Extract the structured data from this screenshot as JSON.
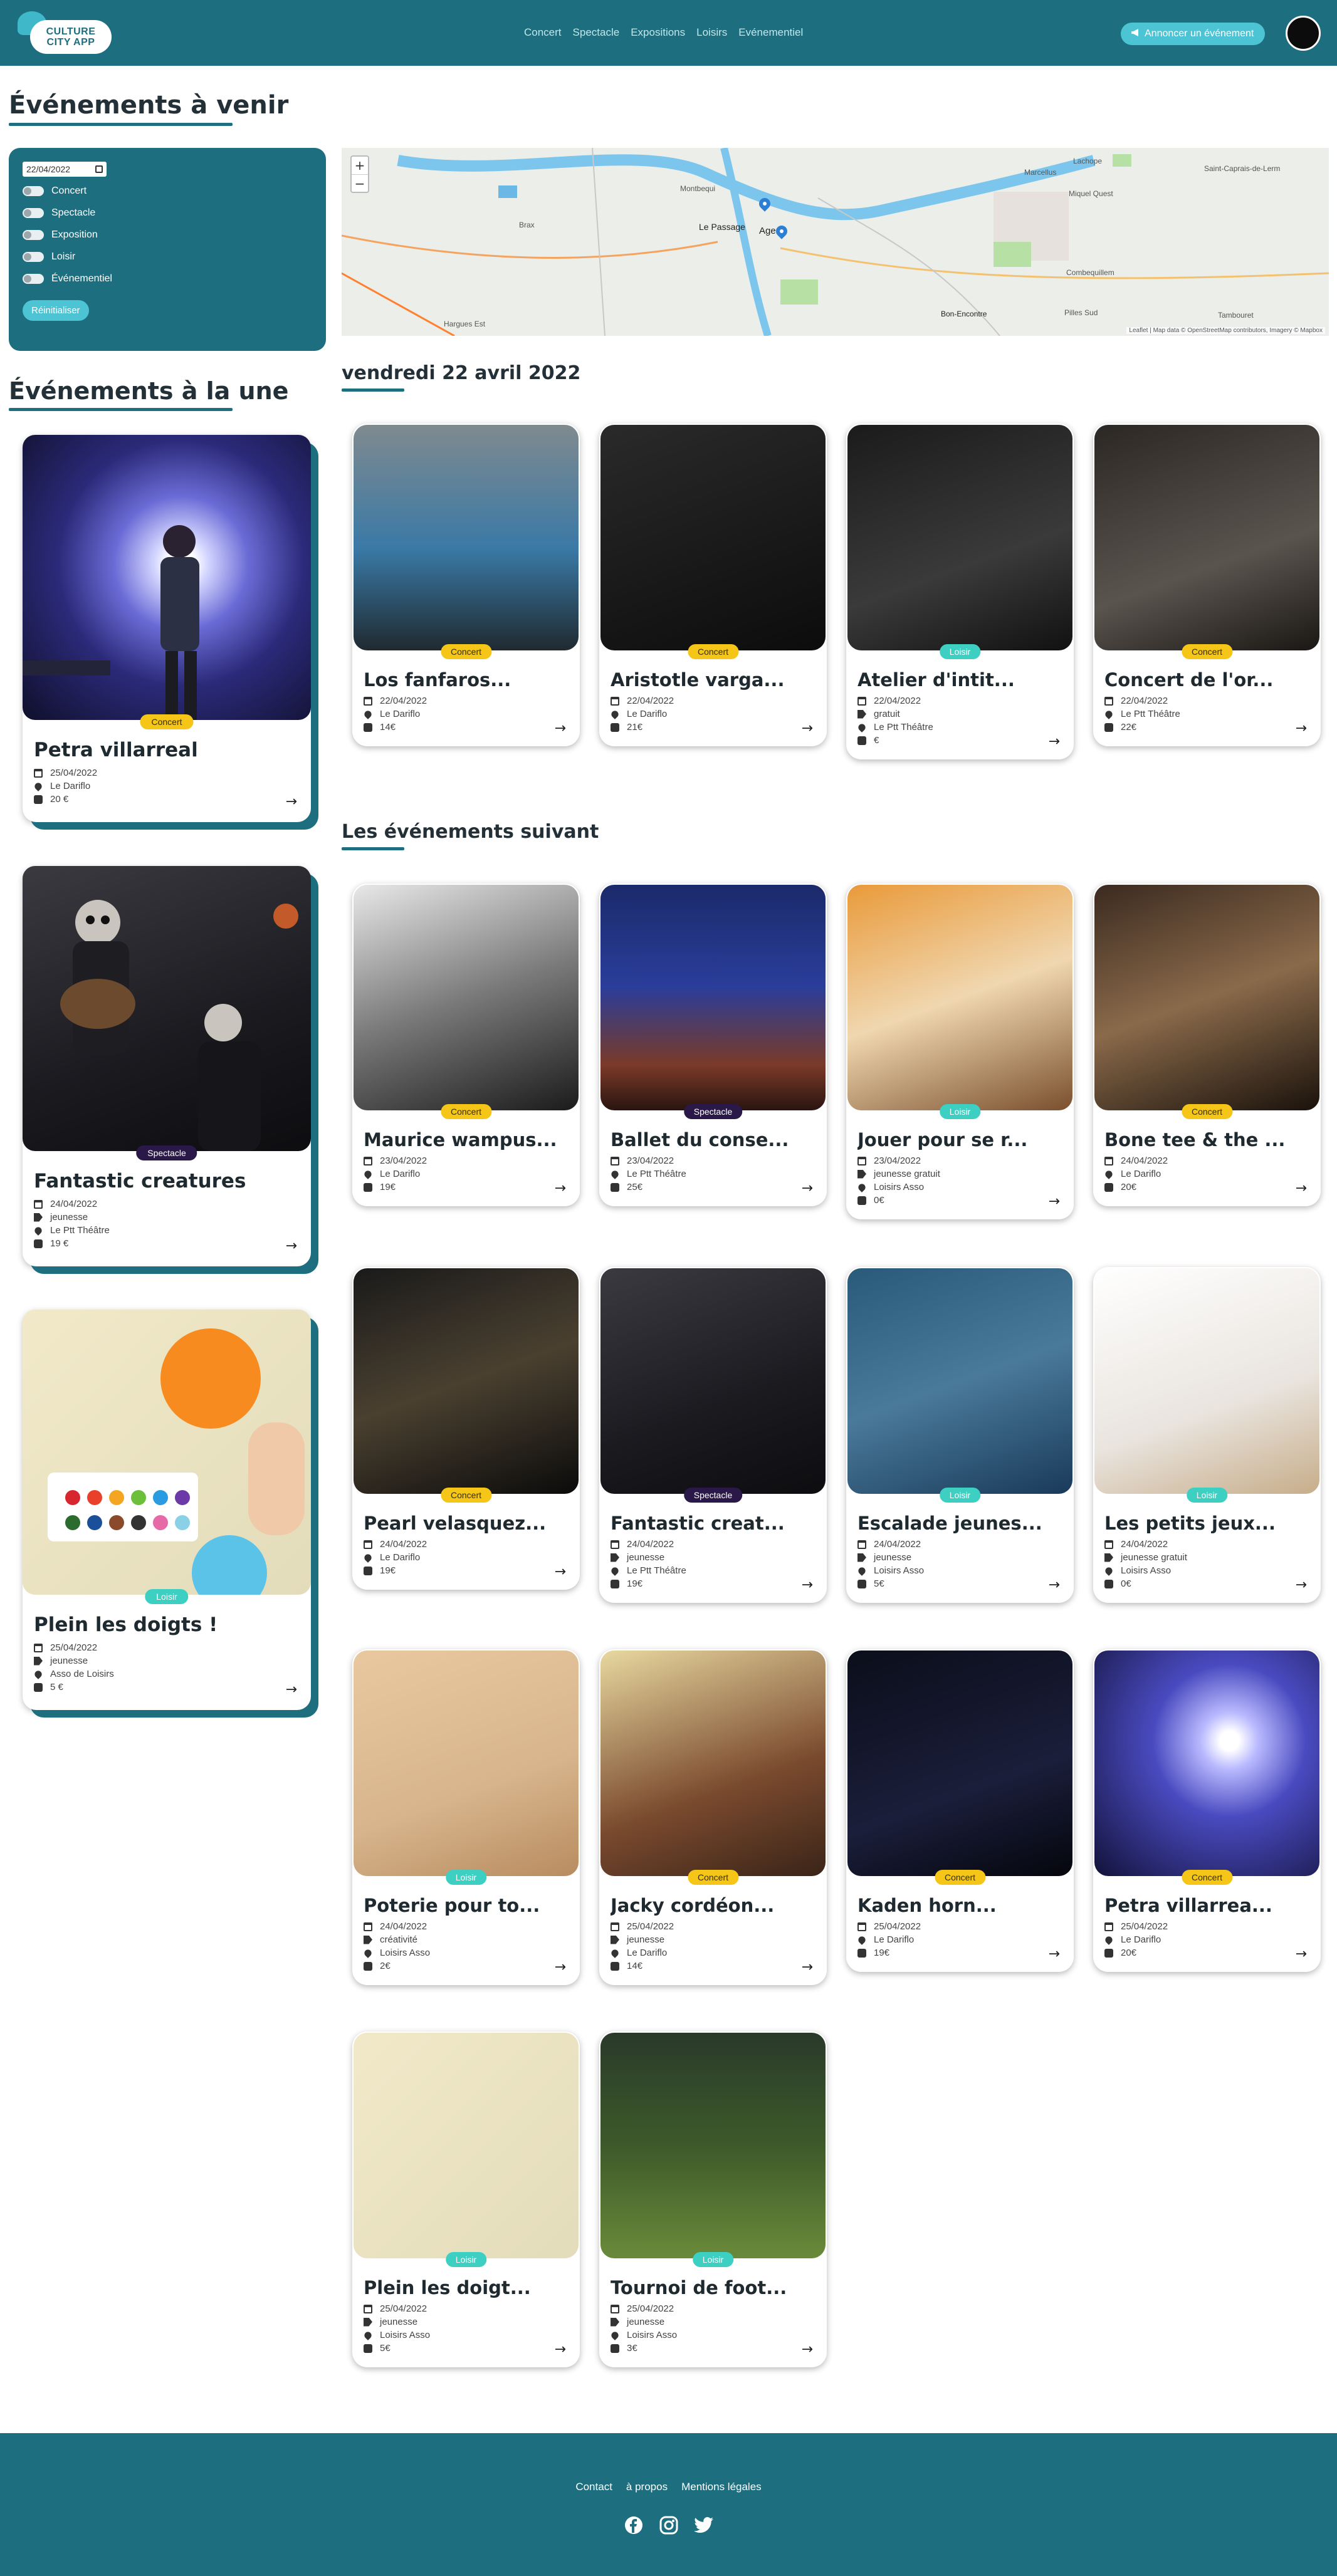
{
  "header": {
    "logo_line1": "CULTURE",
    "logo_line2": "CITY APP",
    "nav": [
      "Concert",
      "Spectacle",
      "Expositions",
      "Loisirs",
      "Evénementiel"
    ],
    "announce_label": "Annoncer un événement"
  },
  "upcoming_title": "Événements à venir",
  "featured_title": "Événements à la une",
  "filters": {
    "date_value": "22/04/2022",
    "options": [
      "Concert",
      "Spectacle",
      "Exposition",
      "Loisir",
      "Événementiel"
    ],
    "reset_label": "Réinitialiser"
  },
  "map": {
    "zoom_in": "+",
    "zoom_out": "−",
    "labels": [
      "Montbequi",
      "Le Passage",
      "Agen",
      "Brax",
      "Bon-Encontre",
      "Lachope",
      "Saint-Caprais-de-Lerm",
      "Marcellus",
      "Miquel Quest",
      "Combequillem",
      "Pilles Sud",
      "Tambouret",
      "Hargues Est"
    ],
    "attribution": "Leaflet | Map data © OpenStreetMap contributors, Imagery © Mapbox"
  },
  "day_title": "vendredi 22 avril 2022",
  "next_title": "Les événements suivant",
  "featured": [
    {
      "title": "Petra villarreal",
      "category": "Concert",
      "date": "25/04/2022",
      "place": "Le Dariflo",
      "price": "20 €"
    },
    {
      "title": "Fantastic creatures",
      "category": "Spectacle",
      "date": "24/04/2022",
      "tag": "jeunesse",
      "place": "Le Ptt Théâtre",
      "price": "19 €"
    },
    {
      "title": "Plein les doigts !",
      "category": "Loisir",
      "date": "25/04/2022",
      "tag": "jeunesse",
      "place": "Asso de Loisirs",
      "price": "5 €"
    }
  ],
  "today": [
    {
      "title": "Los fanfaros...",
      "category": "Concert",
      "date": "22/04/2022",
      "place": "Le Dariflo",
      "price": "14€"
    },
    {
      "title": "Aristotle varga...",
      "category": "Concert",
      "date": "22/04/2022",
      "place": "Le Dariflo",
      "price": "21€"
    },
    {
      "title": "Atelier d'intit...",
      "category": "Loisir",
      "date": "22/04/2022",
      "tag": "gratuit",
      "place": "Le Ptt Théâtre",
      "price": "€"
    },
    {
      "title": "Concert de l'or...",
      "category": "Concert",
      "date": "22/04/2022",
      "place": "Le Ptt Théâtre",
      "price": "22€"
    }
  ],
  "next": [
    {
      "title": "Maurice wampus...",
      "category": "Concert",
      "date": "23/04/2022",
      "place": "Le Dariflo",
      "price": "19€"
    },
    {
      "title": "Ballet du conse...",
      "category": "Spectacle",
      "date": "23/04/2022",
      "place": "Le Ptt Théâtre",
      "price": "25€"
    },
    {
      "title": "Jouer pour se r...",
      "category": "Loisir",
      "date": "23/04/2022",
      "tag": "jeunesse gratuit",
      "place": "Loisirs Asso",
      "price": "0€"
    },
    {
      "title": "Bone tee & the ...",
      "category": "Concert",
      "date": "24/04/2022",
      "place": "Le Dariflo",
      "price": "20€"
    },
    {
      "title": "Pearl velasquez...",
      "category": "Concert",
      "date": "24/04/2022",
      "place": "Le Dariflo",
      "price": "19€"
    },
    {
      "title": "Fantastic creat...",
      "category": "Spectacle",
      "date": "24/04/2022",
      "tag": "jeunesse",
      "place": "Le Ptt Théâtre",
      "price": "19€"
    },
    {
      "title": "Escalade jeunes...",
      "category": "Loisir",
      "date": "24/04/2022",
      "tag": "jeunesse",
      "place": "Loisirs Asso",
      "price": "5€"
    },
    {
      "title": "Les petits jeux...",
      "category": "Loisir",
      "date": "24/04/2022",
      "tag": "jeunesse gratuit",
      "place": "Loisirs Asso",
      "price": "0€"
    },
    {
      "title": "Poterie pour to...",
      "category": "Loisir",
      "date": "24/04/2022",
      "tag": "créativité",
      "place": "Loisirs Asso",
      "price": "2€"
    },
    {
      "title": "Jacky cordéon...",
      "category": "Concert",
      "date": "25/04/2022",
      "tag": "jeunesse",
      "place": "Le Dariflo",
      "price": "14€"
    },
    {
      "title": "Kaden horn...",
      "category": "Concert",
      "date": "25/04/2022",
      "place": "Le Dariflo",
      "price": "19€"
    },
    {
      "title": "Petra villarrea...",
      "category": "Concert",
      "date": "25/04/2022",
      "place": "Le Dariflo",
      "price": "20€"
    },
    {
      "title": "Plein les doigt...",
      "category": "Loisir",
      "date": "25/04/2022",
      "tag": "jeunesse",
      "place": "Loisirs Asso",
      "price": "5€"
    },
    {
      "title": "Tournoi de foot...",
      "category": "Loisir",
      "date": "25/04/2022",
      "tag": "jeunesse",
      "place": "Loisirs Asso",
      "price": "3€"
    }
  ],
  "footer": {
    "links": [
      "Contact",
      "à propos",
      "Mentions légales"
    ],
    "social_icons": [
      "facebook-icon",
      "instagram-icon",
      "twitter-icon"
    ]
  },
  "colors": {
    "primary": "#1d6f7f",
    "accent": "#4cc4d4",
    "concert": "#f5c518",
    "spectacle": "#2a1848",
    "loisir": "#3ccfc2"
  }
}
